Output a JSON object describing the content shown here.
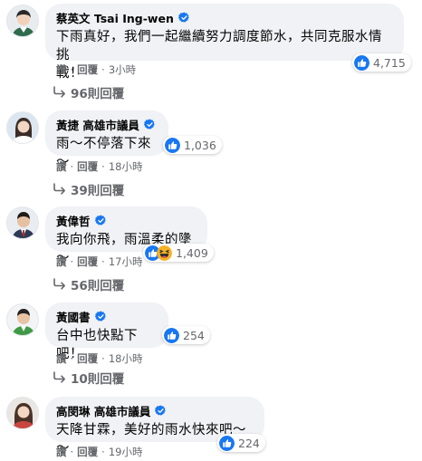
{
  "colors": {
    "verified": "#1877f2",
    "like": "#1877f2",
    "haha": "#f7b125",
    "bubble": "#f0f2f5",
    "meta": "#65676b"
  },
  "icons": {
    "verified": "verified-badge-icon",
    "like": "like-icon",
    "haha": "haha-icon",
    "reply_arrow": "reply-arrow-icon"
  },
  "comments": [
    {
      "author": "蔡英文 Tsai Ing-wen",
      "text_line1": "下雨真好，我們一起繼續努力調度節水，共同克服水情挑",
      "text_line2": "戰！",
      "reaction_count": "4,715",
      "action_like": "讚",
      "action_reply": "回覆",
      "time": "3小時",
      "replies": "96則回覆"
    },
    {
      "author": "黃捷 高雄市議員",
      "text_line1": "雨～不停落下來～",
      "reaction_count": "1,036",
      "action_like": "讚",
      "action_reply": "回覆",
      "time": "18小時",
      "replies": "39則回覆"
    },
    {
      "author": "黃偉哲",
      "text_line1": "我向你飛，雨溫柔的墬～",
      "reaction_count": "1,409",
      "action_like": "讚",
      "action_reply": "回覆",
      "time": "17小時",
      "replies": "56則回覆"
    },
    {
      "author": "黃國書",
      "text_line1": "台中也快點下吧！",
      "reaction_count": "254",
      "action_like": "讚",
      "action_reply": "回覆",
      "time": "18小時",
      "replies": "10則回覆"
    },
    {
      "author": "高閔琳 高雄市議員",
      "text_line1": "天降甘霖，美好的雨水快來吧～～",
      "reaction_count": "224",
      "action_like": "讚",
      "action_reply": "回覆",
      "time": "19小時"
    }
  ]
}
